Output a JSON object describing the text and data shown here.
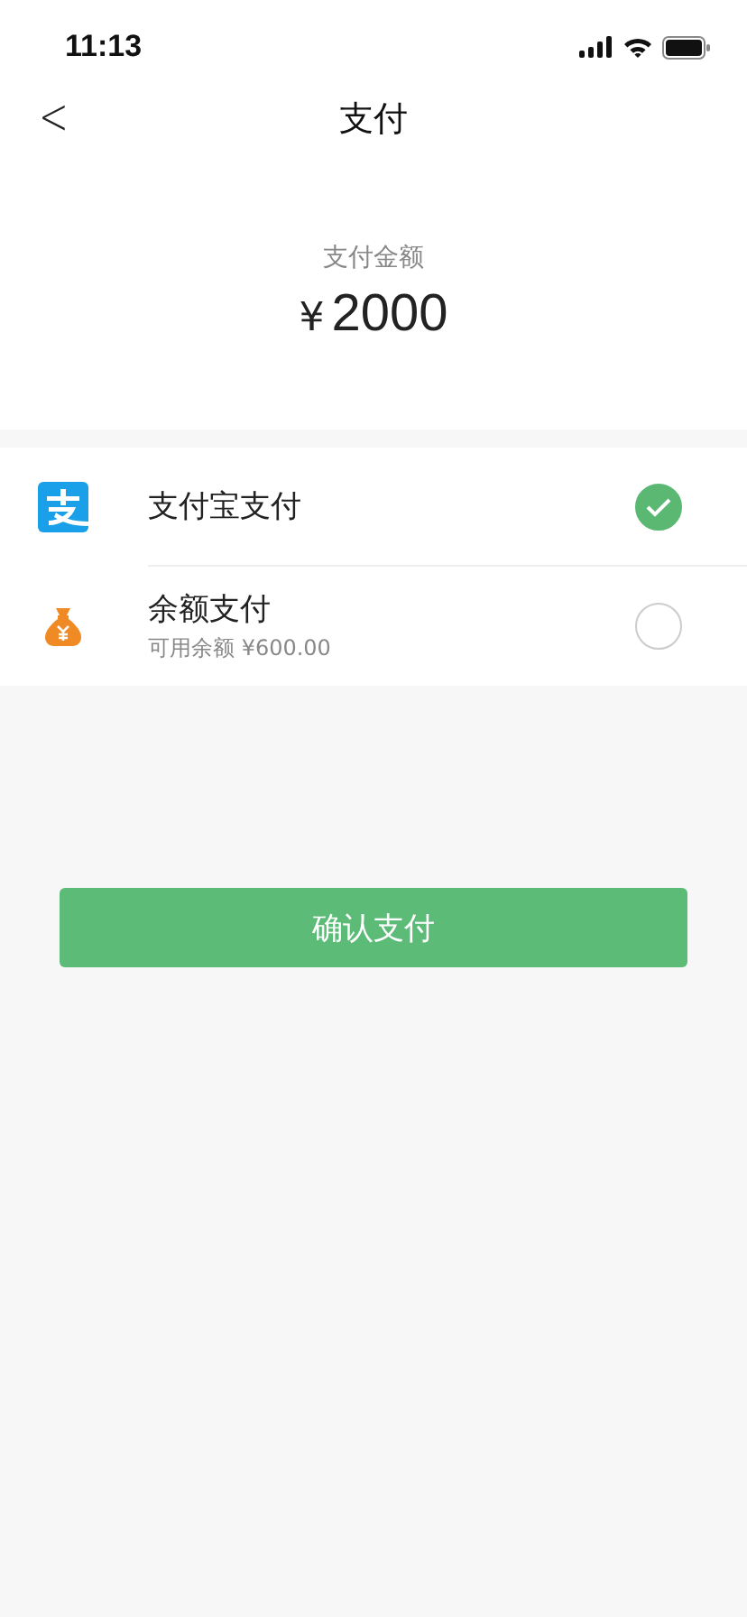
{
  "status_bar": {
    "time": "11:13"
  },
  "nav": {
    "back": "<",
    "title": "支付"
  },
  "amount": {
    "label": "支付金额",
    "currency": "¥",
    "value": "2000"
  },
  "methods": [
    {
      "kind": "app",
      "name": "支付宝支付",
      "selected": true
    },
    {
      "kind": "balance",
      "name": "余额支付",
      "note": "可用余额 ¥600.00",
      "selected": false
    }
  ],
  "confirm_button": "确认支付"
}
